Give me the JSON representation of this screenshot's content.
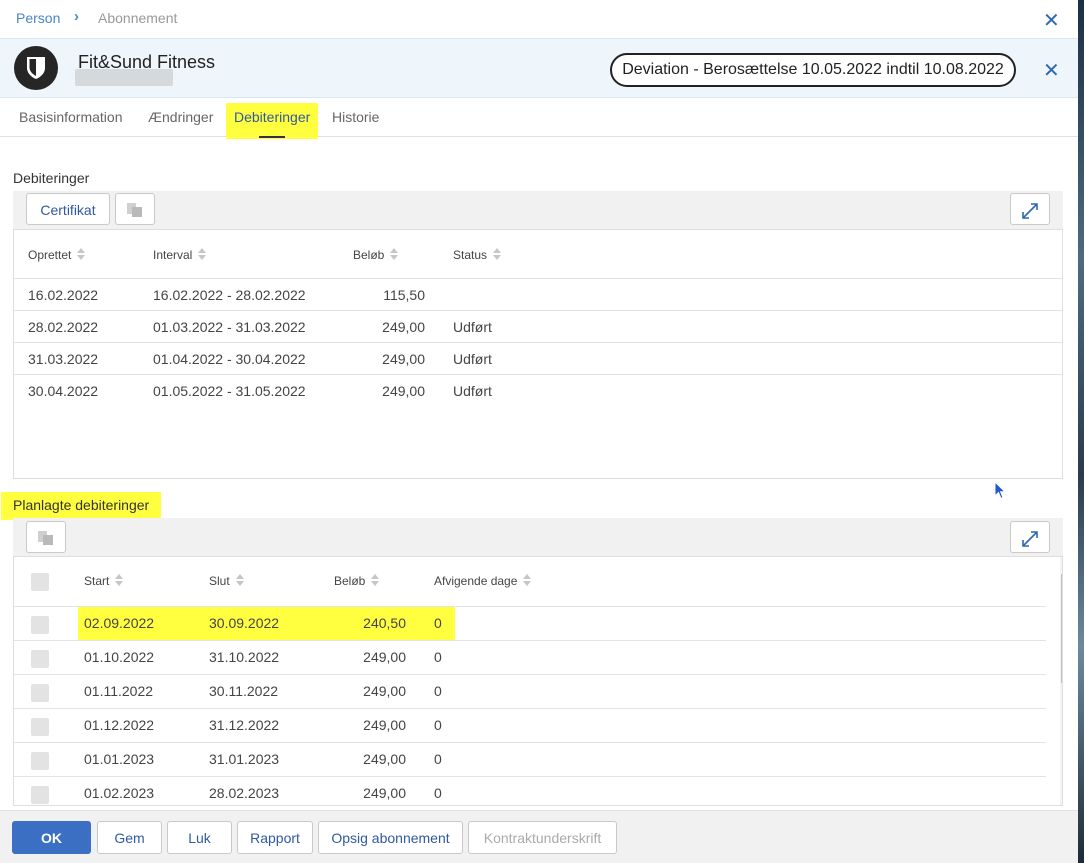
{
  "breadcrumb": {
    "root": "Person",
    "separator": "›",
    "current": "Abonnement"
  },
  "header": {
    "member_name": "Fit&Sund Fitness",
    "deviation": "Deviation - Berosættelse 10.05.2022 indtil 10.08.2022"
  },
  "tabs": [
    {
      "label": "Basisinformation"
    },
    {
      "label": "Ændringer"
    },
    {
      "label": "Debiteringer",
      "active": true
    },
    {
      "label": "Historie"
    }
  ],
  "debits": {
    "title": "Debiteringer",
    "certificate_button": "Certifikat",
    "columns": [
      "Oprettet",
      "Interval",
      "Beløb",
      "Status"
    ],
    "rows": [
      {
        "created": "16.02.2022",
        "interval": "16.02.2022 - 28.02.2022",
        "amount": "115,50",
        "status": ""
      },
      {
        "created": "28.02.2022",
        "interval": "01.03.2022 - 31.03.2022",
        "amount": "249,00",
        "status": "Udført"
      },
      {
        "created": "31.03.2022",
        "interval": "01.04.2022 - 30.04.2022",
        "amount": "249,00",
        "status": "Udført"
      },
      {
        "created": "30.04.2022",
        "interval": "01.05.2022 - 31.05.2022",
        "amount": "249,00",
        "status": "Udført"
      }
    ]
  },
  "planned": {
    "title": "Planlagte debiteringer",
    "columns": [
      "Start",
      "Slut",
      "Beløb",
      "Afvigende dage"
    ],
    "rows": [
      {
        "start": "02.09.2022",
        "end": "30.09.2022",
        "amount": "240,50",
        "days": "0",
        "highlighted": true
      },
      {
        "start": "01.10.2022",
        "end": "31.10.2022",
        "amount": "249,00",
        "days": "0"
      },
      {
        "start": "01.11.2022",
        "end": "30.11.2022",
        "amount": "249,00",
        "days": "0"
      },
      {
        "start": "01.12.2022",
        "end": "31.12.2022",
        "amount": "249,00",
        "days": "0"
      },
      {
        "start": "01.01.2023",
        "end": "31.01.2023",
        "amount": "249,00",
        "days": "0"
      },
      {
        "start": "01.02.2023",
        "end": "28.02.2023",
        "amount": "249,00",
        "days": "0"
      }
    ]
  },
  "footer": {
    "ok": "OK",
    "save": "Gem",
    "close": "Luk",
    "report": "Rapport",
    "cancel_subscription": "Opsig abonnement",
    "contract_signature": "Kontraktunderskrift"
  },
  "icons": {
    "close": "close-icon",
    "copy": "copy-icon",
    "expand": "expand-icon",
    "sort": "sort-icon",
    "shield": "shield-icon"
  },
  "colors": {
    "accent": "#2f67b3",
    "highlight": "#ffff40",
    "primary_button": "#3a6fc4"
  }
}
